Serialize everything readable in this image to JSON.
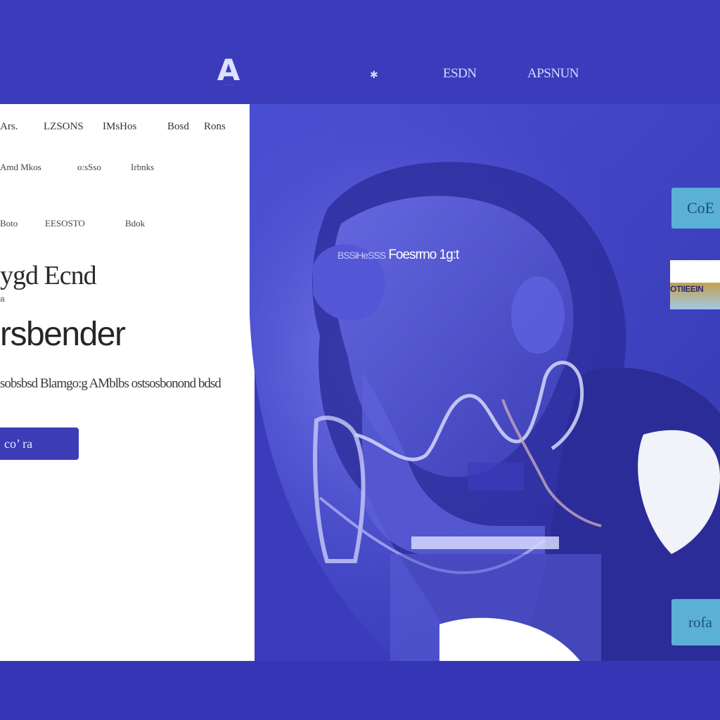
{
  "header": {
    "logo_mark": "A",
    "logo_sub": "·····",
    "nav_icon": "✱",
    "nav_item_1": "ESDN",
    "nav_item_2": "APSNUN"
  },
  "secondary_nav": {
    "row1": [
      "Ars.",
      "LZSONS",
      "IMsHos",
      "Bosd",
      "Rons"
    ],
    "row2": [
      "Amd Mkos",
      "o:sSso",
      "Irbnks"
    ],
    "row3": [
      "Boto",
      "EESOSTO",
      "Bdok"
    ]
  },
  "hero": {
    "headline_1": "ygd Ecnd",
    "headline_mark": "a",
    "headline_2": "rsbender",
    "subtitle": "sobsbsd Blamgo:g AMblbs ostsosbonond bdsd",
    "cta_label": "co’ ra",
    "caption_dim": "BSSiHeSSS",
    "caption_main": "Foesrrno 1g:t"
  },
  "side_panel": {
    "button_1": "CoE",
    "card_label": "OTIIEEIN",
    "button_3": "rofa"
  },
  "colors": {
    "brand_blue": "#3a3cbc",
    "cta_blue": "#3b3cb6",
    "side_button": "#5ab0d6",
    "panel_white": "#ffffff"
  }
}
